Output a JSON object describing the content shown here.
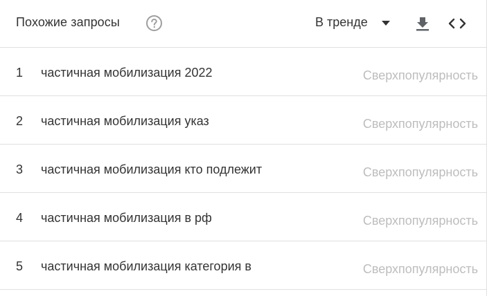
{
  "header": {
    "title": "Похожие запросы",
    "filter_label": "В тренде",
    "help_icon": "help-circle-icon",
    "download_icon": "download-icon",
    "embed_icon": "code-embed-icon",
    "caret_icon": "dropdown-caret-icon"
  },
  "rows": [
    {
      "rank": "1",
      "query": "частичная мобилизация 2022",
      "value": "Сверхпопулярность"
    },
    {
      "rank": "2",
      "query": "частичная мобилизация указ",
      "value": "Сверхпопулярность"
    },
    {
      "rank": "3",
      "query": "частичная мобилизация кто подлежит",
      "value": "Сверхпопулярность"
    },
    {
      "rank": "4",
      "query": "частичная мобилизация в рф",
      "value": "Сверхпопулярность"
    },
    {
      "rank": "5",
      "query": "частичная мобилизация категория в",
      "value": "Сверхпопулярность"
    }
  ],
  "colors": {
    "text": "#333333",
    "muted": "#bdbdbd",
    "icon": "#5f6368",
    "divider": "#e0e0e0"
  }
}
